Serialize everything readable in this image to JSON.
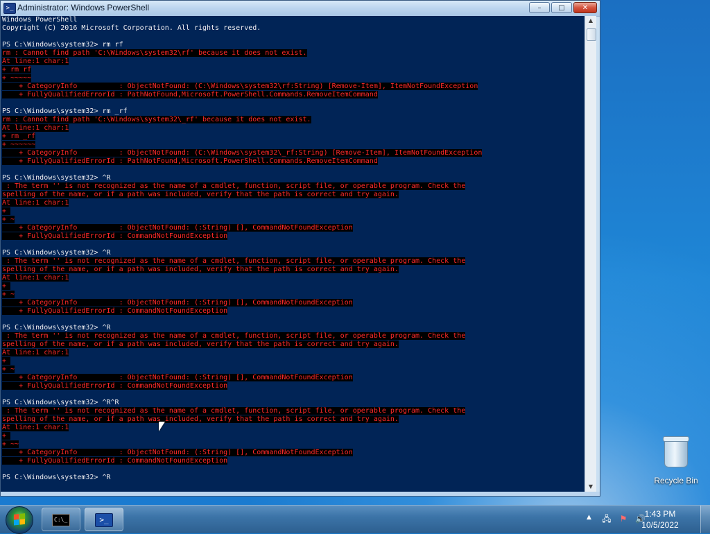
{
  "window": {
    "title": "Administrator: Windows PowerShell",
    "icon": "powershell-icon",
    "minimize": "–",
    "maximize": "□",
    "close": "✕"
  },
  "console": {
    "lines": [
      {
        "t": "Windows PowerShell",
        "err": false
      },
      {
        "t": "Copyright (C) 2016 Microsoft Corporation. All rights reserved.",
        "err": false
      },
      {
        "t": "",
        "err": false
      },
      {
        "t": "PS C:\\Windows\\system32> rm rf",
        "err": false
      },
      {
        "t": "rm : Cannot find path 'C:\\Windows\\system32\\rf' because it does not exist.",
        "err": true
      },
      {
        "t": "At line:1 char:1",
        "err": true
      },
      {
        "t": "+ rm rf",
        "err": true
      },
      {
        "t": "+ ~~~~~",
        "err": true
      },
      {
        "t": "    + CategoryInfo          : ObjectNotFound: (C:\\Windows\\system32\\rf:String) [Remove-Item], ItemNotFoundException",
        "err": true
      },
      {
        "t": "    + FullyQualifiedErrorId : PathNotFound,Microsoft.PowerShell.Commands.RemoveItemCommand",
        "err": true
      },
      {
        "t": "",
        "err": false
      },
      {
        "t": "PS C:\\Windows\\system32> rm _rf",
        "err": false
      },
      {
        "t": "rm : Cannot find path 'C:\\Windows\\system32\\_rf' because it does not exist.",
        "err": true
      },
      {
        "t": "At line:1 char:1",
        "err": true
      },
      {
        "t": "+ rm _rf",
        "err": true
      },
      {
        "t": "+ ~~~~~~",
        "err": true
      },
      {
        "t": "    + CategoryInfo          : ObjectNotFound: (C:\\Windows\\system32\\_rf:String) [Remove-Item], ItemNotFoundException",
        "err": true
      },
      {
        "t": "    + FullyQualifiedErrorId : PathNotFound,Microsoft.PowerShell.Commands.RemoveItemCommand",
        "err": true
      },
      {
        "t": "",
        "err": false
      },
      {
        "t": "PS C:\\Windows\\system32> ^R",
        "err": false
      },
      {
        "t": " : The term '' is not recognized as the name of a cmdlet, function, script file, or operable program. Check the",
        "err": true
      },
      {
        "t": "spelling of the name, or if a path was included, verify that the path is correct and try again.",
        "err": true
      },
      {
        "t": "At line:1 char:1",
        "err": true
      },
      {
        "t": "+ ",
        "err": true
      },
      {
        "t": "+ ~",
        "err": true
      },
      {
        "t": "    + CategoryInfo          : ObjectNotFound: (:String) [], CommandNotFoundException",
        "err": true
      },
      {
        "t": "    + FullyQualifiedErrorId : CommandNotFoundException",
        "err": true
      },
      {
        "t": "",
        "err": false
      },
      {
        "t": "PS C:\\Windows\\system32> ^R",
        "err": false
      },
      {
        "t": " : The term '' is not recognized as the name of a cmdlet, function, script file, or operable program. Check the",
        "err": true
      },
      {
        "t": "spelling of the name, or if a path was included, verify that the path is correct and try again.",
        "err": true
      },
      {
        "t": "At line:1 char:1",
        "err": true
      },
      {
        "t": "+ ",
        "err": true
      },
      {
        "t": "+ ~",
        "err": true
      },
      {
        "t": "    + CategoryInfo          : ObjectNotFound: (:String) [], CommandNotFoundException",
        "err": true
      },
      {
        "t": "    + FullyQualifiedErrorId : CommandNotFoundException",
        "err": true
      },
      {
        "t": "",
        "err": false
      },
      {
        "t": "PS C:\\Windows\\system32> ^R",
        "err": false
      },
      {
        "t": " : The term '' is not recognized as the name of a cmdlet, function, script file, or operable program. Check the",
        "err": true
      },
      {
        "t": "spelling of the name, or if a path was included, verify that the path is correct and try again.",
        "err": true
      },
      {
        "t": "At line:1 char:1",
        "err": true
      },
      {
        "t": "+ ",
        "err": true
      },
      {
        "t": "+ ~",
        "err": true
      },
      {
        "t": "    + CategoryInfo          : ObjectNotFound: (:String) [], CommandNotFoundException",
        "err": true
      },
      {
        "t": "    + FullyQualifiedErrorId : CommandNotFoundException",
        "err": true
      },
      {
        "t": "",
        "err": false
      },
      {
        "t": "PS C:\\Windows\\system32> ^R^R",
        "err": false
      },
      {
        "t": " : The term '' is not recognized as the name of a cmdlet, function, script file, or operable program. Check the",
        "err": true
      },
      {
        "t": "spelling of the name, or if a path was included, verify that the path is correct and try again.",
        "err": true
      },
      {
        "t": "At line:1 char:1",
        "err": true
      },
      {
        "t": "+ ",
        "err": true
      },
      {
        "t": "+ ~~",
        "err": true
      },
      {
        "t": "    + CategoryInfo          : ObjectNotFound: (:String) [], CommandNotFoundException",
        "err": true
      },
      {
        "t": "    + FullyQualifiedErrorId : CommandNotFoundException",
        "err": true
      },
      {
        "t": "",
        "err": false
      },
      {
        "t": "PS C:\\Windows\\system32> ^R",
        "err": false
      }
    ],
    "colors": {
      "background": "#012456",
      "text": "#eeedf0",
      "error": "#ff2a2a"
    }
  },
  "desktop": {
    "recycle_bin_label": "Recycle Bin"
  },
  "taskbar": {
    "buttons": [
      {
        "name": "cmd-taskbar-button",
        "icon": "command-prompt-icon"
      },
      {
        "name": "powershell-taskbar-button",
        "icon": "powershell-icon"
      }
    ],
    "tray_arrow": "▲",
    "clock_time": "1:43 PM",
    "clock_date": "10/5/2022"
  }
}
